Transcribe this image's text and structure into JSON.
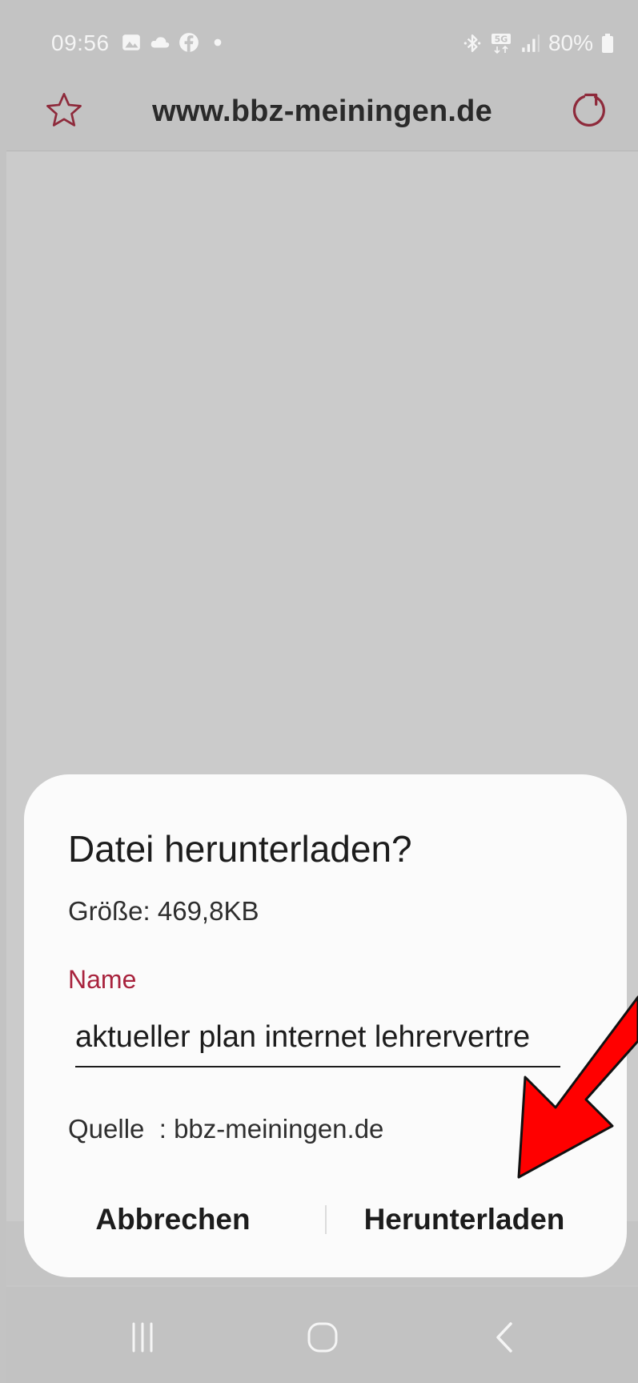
{
  "status_bar": {
    "time": "09:56",
    "left_icons": [
      "gallery-icon",
      "cloud-icon",
      "facebook-icon",
      "dot-icon"
    ],
    "right_icons": [
      "bluetooth-icon",
      "5g-icon",
      "signal-icon"
    ],
    "battery_percent": "80%"
  },
  "toolbar": {
    "url": "www.bbz-meiningen.de",
    "accent_color": "#a8233d"
  },
  "dialog": {
    "title": "Datei herunterladen?",
    "size_text": "Größe: 469,8KB",
    "name_label": "Name",
    "name_value": "aktueller plan internet lehrervertre",
    "source_text": "Quelle  : bbz-meiningen.de",
    "cancel_label": "Abbrechen",
    "download_label": "Herunterladen"
  },
  "nav_bar": {
    "buttons": [
      "recent-apps-icon",
      "home-icon",
      "back-icon"
    ]
  },
  "annotation": {
    "arrow_color": "#ff0000"
  }
}
